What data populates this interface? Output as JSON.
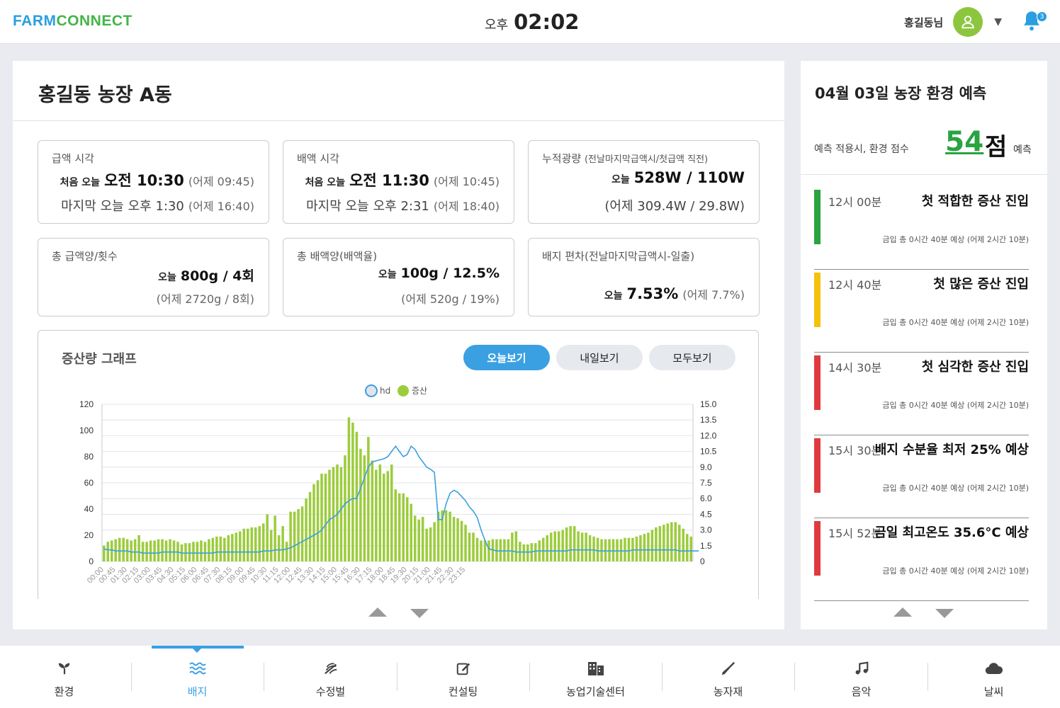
{
  "header": {
    "logo_part1": "FARM",
    "logo_part2": "CONNECT",
    "ampm": "오후",
    "time": "02:02",
    "user_name": "홍길동님",
    "notification_count": "3",
    "accent_color": "#3aa0e2"
  },
  "main": {
    "title": "홍길동 농장 A동",
    "cards": {
      "supply": {
        "label": "급액 시각",
        "first_prefix": "처음 오늘",
        "first_value": "오전 10:30",
        "first_note": "(어제 09:45)",
        "last_prefix": "마지막 오늘",
        "last_value": "오후 1:30",
        "last_note": "(어제 16:40)"
      },
      "drain": {
        "label": "배액 시각",
        "first_prefix": "처음 오늘",
        "first_value": "오전 11:30",
        "first_note": "(어제 10:45)",
        "last_prefix": "마지막 오늘",
        "last_value": "오후 2:31",
        "last_note": "(어제 18:40)"
      },
      "light": {
        "label": "누적광량",
        "label_sub": "(전날마지막급액시/첫급액 직전)",
        "today_prefix": "오늘",
        "today_value": "528W / 110W",
        "yesterday": "(어제 309.4W / 29.8W)"
      },
      "total_supply": {
        "label": "총 급액양/횟수",
        "today_prefix": "오늘",
        "today_value": "800g / 4회",
        "yesterday": "(어제 2720g / 8회)"
      },
      "total_drain": {
        "label": "총 배액양(배액율)",
        "today_prefix": "오늘",
        "today_value": "100g / 12.5%",
        "yesterday": "(어제 520g / 19%)"
      },
      "deviation": {
        "label": "배지 편차(전날마지막급액시-일출)",
        "today_prefix": "오늘",
        "today_value": "7.53%",
        "yesterday": "(어제 7.7%)"
      }
    },
    "chart_section": {
      "title": "증산량 그래프",
      "buttons": [
        "오늘보기",
        "내일보기",
        "모두보기"
      ],
      "active_button": 0
    }
  },
  "chart_data": {
    "type": "bar",
    "title": "",
    "legend": [
      "hd",
      "증산"
    ],
    "legend_position": "top-center",
    "grid": true,
    "x_tick_labels": [
      "00:00",
      "00:45",
      "01:30",
      "02:15",
      "03:00",
      "03:45",
      "04:30",
      "05:15",
      "06:00",
      "06:45",
      "07:30",
      "08:15",
      "09:00",
      "09:45",
      "10:30",
      "11:15",
      "12:00",
      "12:45",
      "13:30",
      "14:15",
      "15:00",
      "15:45",
      "16:30",
      "17:15",
      "18:00",
      "18:45",
      "19:30",
      "20:15",
      "21:00",
      "21:45",
      "22:30",
      "23:15"
    ],
    "x_interval_minutes": 15,
    "ylim_left": [
      0,
      120
    ],
    "y_ticks_left": [
      0,
      20,
      40,
      60,
      80,
      100,
      120
    ],
    "ylim_right": [
      0,
      15
    ],
    "y_ticks_right": [
      "0",
      "1.5",
      "3.0",
      "4.5",
      "6.0",
      "7.5",
      "9.0",
      "10.5",
      "12.0",
      "13.5",
      "15.0"
    ],
    "series": [
      {
        "name": "증산",
        "type": "bar",
        "axis": "left",
        "color": "#9ccc3c",
        "values": [
          12,
          15,
          16,
          17,
          18,
          18,
          17,
          16,
          17,
          20,
          15,
          15,
          16,
          16,
          17,
          17,
          16,
          17,
          16,
          15,
          13,
          14,
          14,
          15,
          15,
          16,
          15,
          17,
          18,
          19,
          19,
          18,
          20,
          21,
          22,
          23,
          25,
          25,
          26,
          26,
          27,
          29,
          36,
          24,
          35,
          20,
          27,
          15,
          38,
          38,
          40,
          42,
          48,
          53,
          59,
          62,
          67,
          67,
          70,
          72,
          74,
          72,
          81,
          110,
          106,
          99,
          86,
          81,
          95,
          77,
          70,
          74,
          67,
          69,
          74,
          55,
          52,
          52,
          49,
          44,
          35,
          32,
          34,
          25,
          26,
          30,
          38,
          39,
          39,
          38,
          34,
          33,
          31,
          28,
          22,
          22,
          18,
          16,
          16,
          16,
          17,
          17,
          17,
          17,
          17,
          22,
          23,
          15,
          13,
          13,
          14,
          14,
          16,
          18,
          20,
          22,
          23,
          23,
          24,
          26,
          27,
          27,
          23,
          22,
          22,
          20,
          19,
          18,
          17,
          17,
          17,
          17,
          17,
          17,
          18,
          18,
          18,
          19,
          20,
          21,
          22,
          24,
          26,
          27,
          28,
          29,
          30,
          30,
          28,
          25,
          21,
          19
        ]
      },
      {
        "name": "hd",
        "type": "line",
        "axis": "right",
        "color": "#3aa0e2",
        "values": [
          1.2,
          1.1,
          1.1,
          1.0,
          1.0,
          1.0,
          1.0,
          0.9,
          0.9,
          0.9,
          0.8,
          0.8,
          0.8,
          0.8,
          0.8,
          0.9,
          0.9,
          0.9,
          0.9,
          0.9,
          0.8,
          0.8,
          0.8,
          0.8,
          0.8,
          0.8,
          0.8,
          0.8,
          0.8,
          0.9,
          0.9,
          0.9,
          0.9,
          0.9,
          0.9,
          0.9,
          0.9,
          0.9,
          0.9,
          0.9,
          0.9,
          1.0,
          1.0,
          1.0,
          1.1,
          1.1,
          1.1,
          1.2,
          1.3,
          1.5,
          1.7,
          1.9,
          2.1,
          2.3,
          2.5,
          2.7,
          3.0,
          3.5,
          4.0,
          4.2,
          4.5,
          5.0,
          5.5,
          5.8,
          6.0,
          6.0,
          7.0,
          8.0,
          9.0,
          9.5,
          9.6,
          9.7,
          9.8,
          10.0,
          10.5,
          11.0,
          10.5,
          10.0,
          10.2,
          11.0,
          10.7,
          10.0,
          9.5,
          9.0,
          8.8,
          8.5,
          4.0,
          4.0,
          5.5,
          6.5,
          6.8,
          6.6,
          6.2,
          5.8,
          5.2,
          4.8,
          4.2,
          3.0,
          2.0,
          1.2,
          1.1,
          1.0,
          1.0,
          1.0,
          1.0,
          1.0,
          0.9,
          0.9,
          0.9,
          0.9,
          0.9,
          1.0,
          1.0,
          1.0,
          1.0,
          1.0,
          1.0,
          1.0,
          1.0,
          1.0,
          1.1,
          1.1,
          1.1,
          1.1,
          1.1,
          1.1,
          1.1,
          1.0,
          1.0,
          1.0,
          1.0,
          1.0,
          1.0,
          1.0,
          1.0,
          1.0,
          1.1,
          1.1,
          1.1,
          1.1,
          1.1,
          1.1,
          1.1,
          1.1,
          1.1,
          1.1,
          1.1,
          1.1,
          1.0,
          1.0,
          1.0,
          1.0,
          1.0,
          1.0
        ]
      }
    ]
  },
  "forecast": {
    "title": "04월 03일 농장 환경 예측",
    "score_label": "예측 적용시, 환경 점수",
    "score": "54",
    "score_unit": "점",
    "score_suffix": "예측",
    "items": [
      {
        "time": "12시 00분",
        "text": "첫 적합한 증산 진입",
        "sub": "금입 총 0시간 40분 예상 (어제 2시간 10분)",
        "color": "#2aa340"
      },
      {
        "time": "12시 40분",
        "text": "첫 많은 증산 진입",
        "sub": "금입 총 0시간 40분 예상 (어제 2시간 10분)",
        "color": "#f5c20b"
      },
      {
        "time": "14시 30분",
        "text": "첫 심각한 증산 진입",
        "sub": "금입 총 0시간 40분 예상 (어제 2시간 10분)",
        "color": "#e03a3e"
      },
      {
        "time": "15시 30분",
        "text": "배지 수분율 최저 25% 예상",
        "sub": "금입 총 0시간 40분 예상 (어제 2시간 10분)",
        "color": "#e03a3e"
      },
      {
        "time": "15시 52분",
        "text": "금일 최고온도 35.6°C 예상",
        "sub": "금입 총 0시간 40분 예상 (어제 2시간 10분)",
        "color": "#e03a3e"
      }
    ]
  },
  "nav": {
    "items": [
      {
        "label": "환경",
        "icon": "sprout-icon"
      },
      {
        "label": "배지",
        "icon": "water-waves-icon"
      },
      {
        "label": "수정벌",
        "icon": "bee-wing-icon"
      },
      {
        "label": "컨설팅",
        "icon": "edit-note-icon"
      },
      {
        "label": "농업기술센터",
        "icon": "building-icon"
      },
      {
        "label": "농자재",
        "icon": "trowel-icon"
      },
      {
        "label": "음악",
        "icon": "music-note-icon"
      },
      {
        "label": "날씨",
        "icon": "cloud-icon"
      }
    ],
    "active_index": 1
  }
}
